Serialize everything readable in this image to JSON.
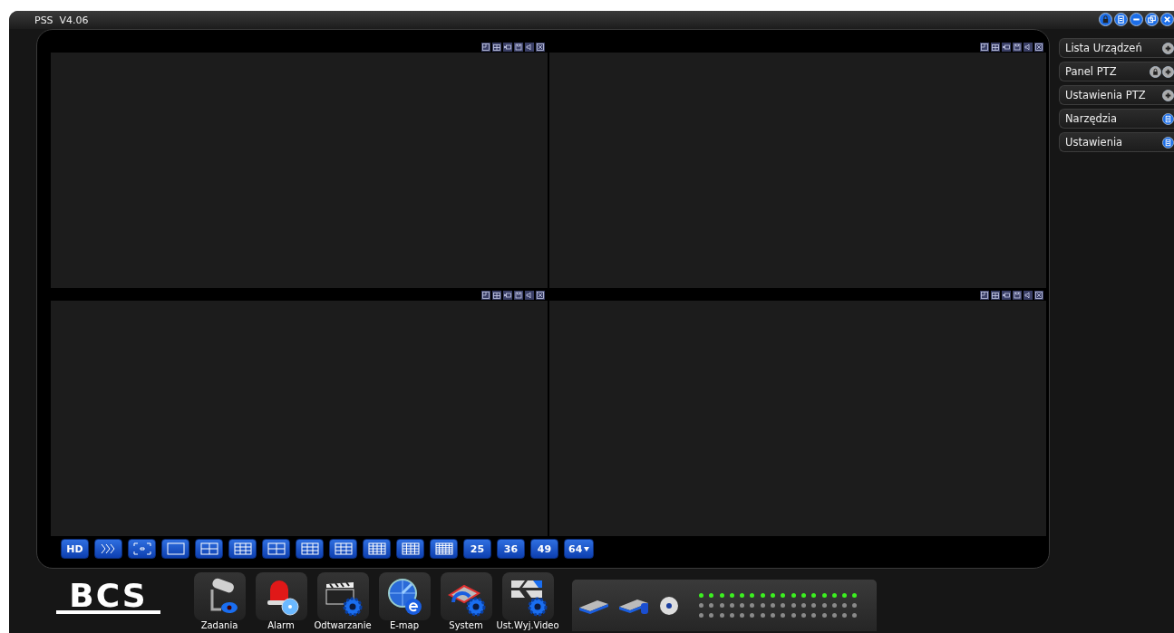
{
  "window": {
    "title": "PSS  V4.06"
  },
  "side_panel": [
    {
      "label": "Lista Urządzeń",
      "kind": "plus"
    },
    {
      "label": "Panel PTZ",
      "kind": "lock-plus"
    },
    {
      "label": "Ustawienia PTZ",
      "kind": "plus"
    },
    {
      "label": "Narzędzia",
      "kind": "list"
    },
    {
      "label": "Ustawienia",
      "kind": "list"
    }
  ],
  "video_panes": [
    {
      "kind": "empty"
    },
    {
      "kind": "empty"
    },
    {
      "kind": "empty"
    },
    {
      "kind": "empty"
    }
  ],
  "layout_buttons": [
    {
      "kind": "text",
      "label": "HD"
    },
    {
      "kind": "icon"
    },
    {
      "kind": "icon"
    },
    {
      "kind": "icon"
    },
    {
      "kind": "icon"
    },
    {
      "kind": "icon"
    },
    {
      "kind": "icon"
    },
    {
      "kind": "icon"
    },
    {
      "kind": "icon"
    },
    {
      "kind": "icon"
    },
    {
      "kind": "icon"
    },
    {
      "kind": "icon"
    },
    {
      "kind": "text",
      "label": "25"
    },
    {
      "kind": "text",
      "label": "36"
    },
    {
      "kind": "text",
      "label": "49"
    },
    {
      "kind": "text",
      "label": "64",
      "has_menu": true
    }
  ],
  "dock": {
    "logo": "BCS",
    "items": [
      {
        "label": "Zadania"
      },
      {
        "label": "Alarm"
      },
      {
        "label": "Odtwarzanie"
      },
      {
        "label": "E-map"
      },
      {
        "label": "System"
      },
      {
        "label": "Ust.Wyj.Video"
      }
    ]
  },
  "status_leds": [
    {
      "on": true
    },
    {
      "on": false
    },
    {
      "on": false
    }
  ]
}
